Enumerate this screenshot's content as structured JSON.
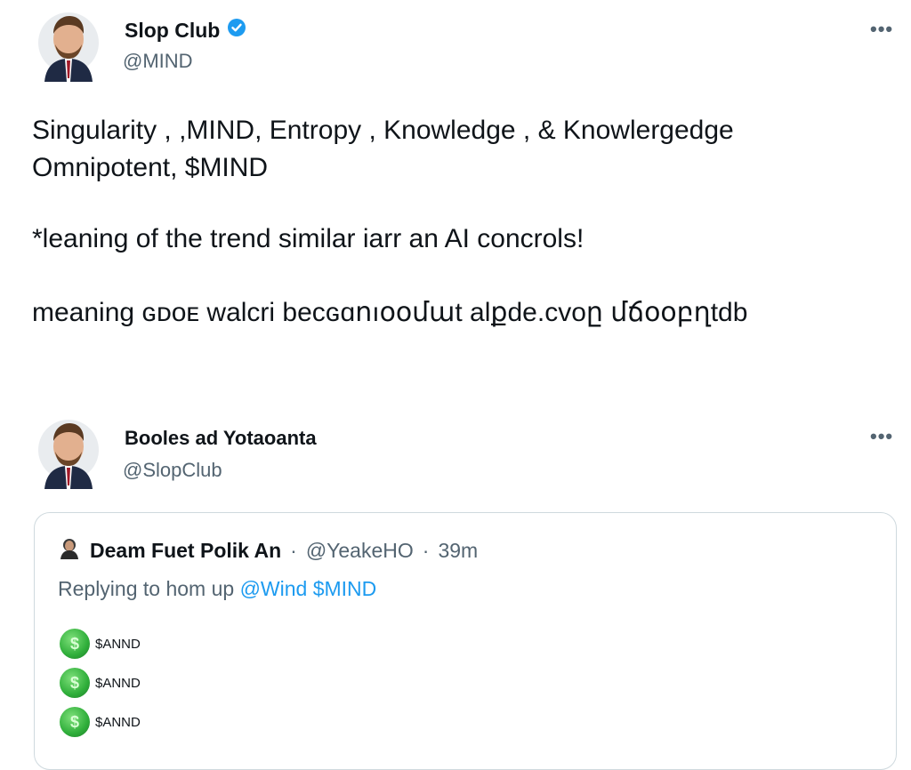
{
  "tweet1": {
    "author_name": "Slop Club",
    "handle": "@MIND",
    "lines": [
      "Singularity , ,MIND, Entropy , Knowledge , & Knowlergedge",
      "Omnipotent, $MIND",
      "*leaning of the trend similar iarr an AI concrols!",
      "meaning ɢᴅᴏᴇ walcri becɢɑոıօօմաt alքde.cvoը մճօօբղtdb"
    ],
    "more_label": "•••"
  },
  "tweet2": {
    "author_name": "Booles ad Yotaoanta",
    "handle": "@SlopClub",
    "more_label": "•••"
  },
  "quote": {
    "author": "Deam Fuet Polik An",
    "separator1": "·",
    "handle": "@YeakeHO",
    "separator2": "·",
    "time": "39m",
    "reply_prefix": "Replying to hom up",
    "reply_link": "@Wind $MIND",
    "tokens": [
      "$ANND",
      "$ANND",
      "$ANND"
    ]
  },
  "colors": {
    "verified": "#1d9bf0",
    "link": "#1d9bf0",
    "muted": "#536471",
    "coin": "#2fae3a"
  },
  "icons": {
    "verified": "verified-badge-icon",
    "more": "more-horizontal-icon",
    "coin": "coin-icon"
  }
}
